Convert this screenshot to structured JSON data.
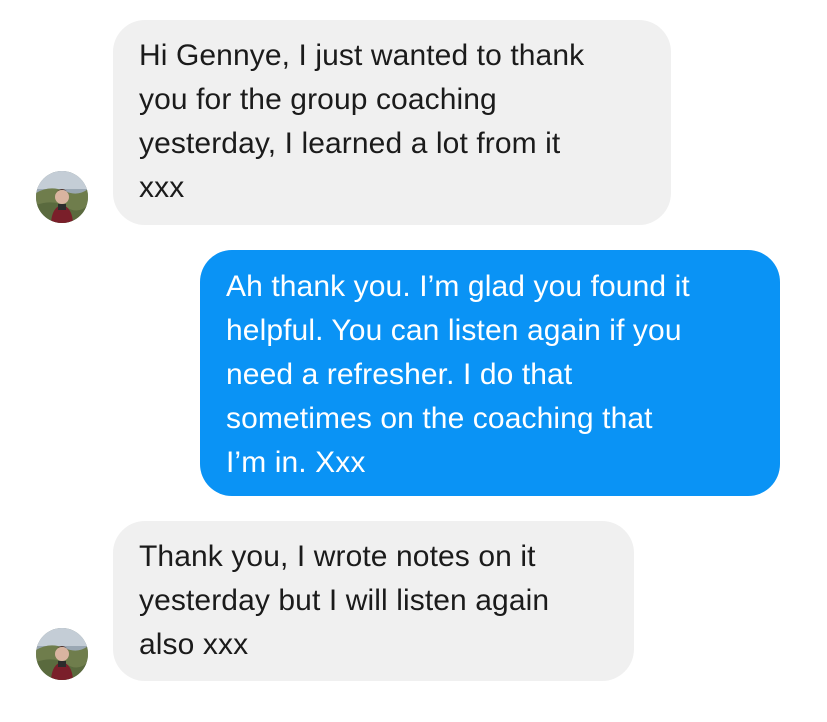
{
  "conversation": {
    "messages": [
      {
        "direction": "incoming",
        "text": "Hi Gennye, I just wanted to thank\nyou for the group coaching\nyesterday, I learned a lot from it\nxxx"
      },
      {
        "direction": "outgoing",
        "text": "Ah thank you. I’m glad you found it\nhelpful. You can listen again if you\nneed a refresher. I do that\nsometimes on the coaching that\nI’m in. Xxx"
      },
      {
        "direction": "incoming",
        "text": "Thank you, I wrote notes on it\nyesterday but I will listen again\nalso xxx"
      }
    ]
  },
  "colors": {
    "incoming_bubble": "#f0f0f0",
    "outgoing_bubble": "#0a93f5",
    "incoming_text": "#1b1b1b",
    "outgoing_text": "#ffffff"
  }
}
